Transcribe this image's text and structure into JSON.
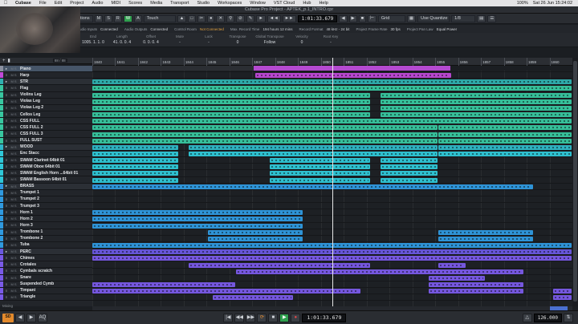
{
  "menubar": {
    "items": [
      "Cubase",
      "File",
      "Edit",
      "Project",
      "Audio",
      "MIDI",
      "Scores",
      "Media",
      "Transport",
      "Studio",
      "Workspaces",
      "Window",
      "VST Cloud",
      "Hub",
      "Help"
    ],
    "status": [
      "100%",
      "Sat 26 Jun 15:24:02"
    ]
  },
  "window_title": "Cubase Pro Project - APTEK_p.1_INTRO.cpr",
  "toolbar": {
    "touch_label": "Touch",
    "time": "1:01:33.679",
    "grid_label": "Grid",
    "quantize_label": "Use Quantize",
    "quantize_value": "1/8",
    "constrain_label": "tions",
    "buttons": [
      "M",
      "S",
      "R",
      "W",
      "A"
    ]
  },
  "infoline": [
    {
      "label": "Audio Inputs",
      "value": "Connected",
      "cls": "ok"
    },
    {
      "label": "Audio Outputs",
      "value": "Connected",
      "cls": "ok"
    },
    {
      "label": "Control Room",
      "value": "Not Connected",
      "cls": "warn"
    },
    {
      "label": "Max. Record Time",
      "value": "194 hours 12 mins",
      "cls": "ok"
    },
    {
      "label": "Record Format",
      "value": "48 kHz - 24 bit",
      "cls": "ok"
    },
    {
      "label": "Project Frame Rate",
      "value": "30 fps",
      "cls": "ok"
    },
    {
      "label": "Project Pan Law",
      "value": "Equal Power",
      "cls": "ok"
    }
  ],
  "infocols": [
    {
      "h": "End",
      "v": "1005. 1. 1. 0"
    },
    {
      "h": "Length",
      "v": "41. 0. 0. 4"
    },
    {
      "h": "Offset",
      "v": "0. 0. 0. 4"
    },
    {
      "h": "Mute",
      "v": "-"
    },
    {
      "h": "Lock",
      "v": "-"
    },
    {
      "h": "Transpose",
      "v": "0"
    },
    {
      "h": "Global Transpose",
      "v": "Follow"
    },
    {
      "h": "Velocity",
      "v": "0"
    },
    {
      "h": "Root Key",
      "v": "-"
    }
  ],
  "track_count": "88 / 88",
  "ruler": [
    "1840",
    "1841",
    "1842",
    "1843",
    "1844",
    "1845",
    "1846",
    "1847",
    "1848",
    "1849",
    "1850",
    "1851",
    "1852",
    "1853",
    "1854",
    "1855",
    "1856",
    "1857",
    "1858",
    "1859",
    "1860"
  ],
  "tracks": [
    {
      "name": "Piano",
      "color": "#8a90a0",
      "folder": true,
      "selected": true
    },
    {
      "name": "Harp",
      "color": "#c04ad8",
      "folder": false
    },
    {
      "name": "STR",
      "color": "#2fb0b0",
      "folder": true
    },
    {
      "name": "Flag",
      "color": "#38c7a0",
      "folder": false
    },
    {
      "name": "Violins Leg",
      "color": "#38c7a0",
      "folder": false
    },
    {
      "name": "Violas Leg",
      "color": "#38c7a0",
      "folder": false
    },
    {
      "name": "Violas Leg 2",
      "color": "#38c7a0",
      "folder": false
    },
    {
      "name": "Cellos Leg",
      "color": "#38c7a0",
      "folder": false
    },
    {
      "name": "CSS FULL",
      "color": "#38c7a0",
      "folder": false
    },
    {
      "name": "CSS FULL 2",
      "color": "#38c7a0",
      "folder": false
    },
    {
      "name": "CSS FULL 3",
      "color": "#38c7a0",
      "folder": false
    },
    {
      "name": "FULL SUST",
      "color": "#38c7a0",
      "folder": false
    },
    {
      "name": "WOOD",
      "color": "#2fb8c8",
      "folder": true
    },
    {
      "name": "Enc Stacc",
      "color": "#2fc8d8",
      "folder": false
    },
    {
      "name": "SWAM Clarinet 64bit 01",
      "color": "#2fc8d8",
      "folder": false
    },
    {
      "name": "SWAM Oboe 64bit 01",
      "color": "#2fc8d8",
      "folder": false
    },
    {
      "name": "SWAM English Horn ...64bit 01",
      "color": "#2fc8d8",
      "folder": false
    },
    {
      "name": "SWAM Bassoon 64bit 01",
      "color": "#2fc8d8",
      "folder": false
    },
    {
      "name": "BRASS",
      "color": "#2f9ae0",
      "folder": true
    },
    {
      "name": "Trumpet 1",
      "color": "#2f9ae0",
      "folder": false
    },
    {
      "name": "Trumpet 2",
      "color": "#2f9ae0",
      "folder": false
    },
    {
      "name": "Trumpet 3",
      "color": "#2f9ae0",
      "folder": false
    },
    {
      "name": "Horn 1",
      "color": "#2f9ae0",
      "folder": false
    },
    {
      "name": "Horn 2",
      "color": "#2f9ae0",
      "folder": false
    },
    {
      "name": "Horn 3",
      "color": "#2f9ae0",
      "folder": false
    },
    {
      "name": "Trombone 1",
      "color": "#2f9ae0",
      "folder": false
    },
    {
      "name": "Trombone 2",
      "color": "#2f9ae0",
      "folder": false
    },
    {
      "name": "Tuba",
      "color": "#2f9ae0",
      "folder": false
    },
    {
      "name": "PERC",
      "color": "#6a58e0",
      "folder": true
    },
    {
      "name": "Chimes",
      "color": "#7a5ae8",
      "folder": false
    },
    {
      "name": "Crotales",
      "color": "#7a5ae8",
      "folder": false
    },
    {
      "name": "Cymbals scratch",
      "color": "#7a5ae8",
      "folder": false
    },
    {
      "name": "Snare",
      "color": "#7a5ae8",
      "folder": false
    },
    {
      "name": "Suspended Cymb",
      "color": "#7a5ae8",
      "folder": false
    },
    {
      "name": "Timpani",
      "color": "#7a5ae8",
      "folder": false
    },
    {
      "name": "Triangle",
      "color": "#7a5ae8",
      "folder": false
    }
  ],
  "transport": {
    "time": "1:01:33.679",
    "tempo": "126.000",
    "aq_label": "AQ",
    "mixing_label": "Mixing"
  },
  "colors": {
    "harp": "#c04ad8",
    "strings": "#38c7a0",
    "wood": "#2fc8d8",
    "brass": "#2f9ae0",
    "perc": "#7a5ae8",
    "play": "#2fa04e"
  }
}
